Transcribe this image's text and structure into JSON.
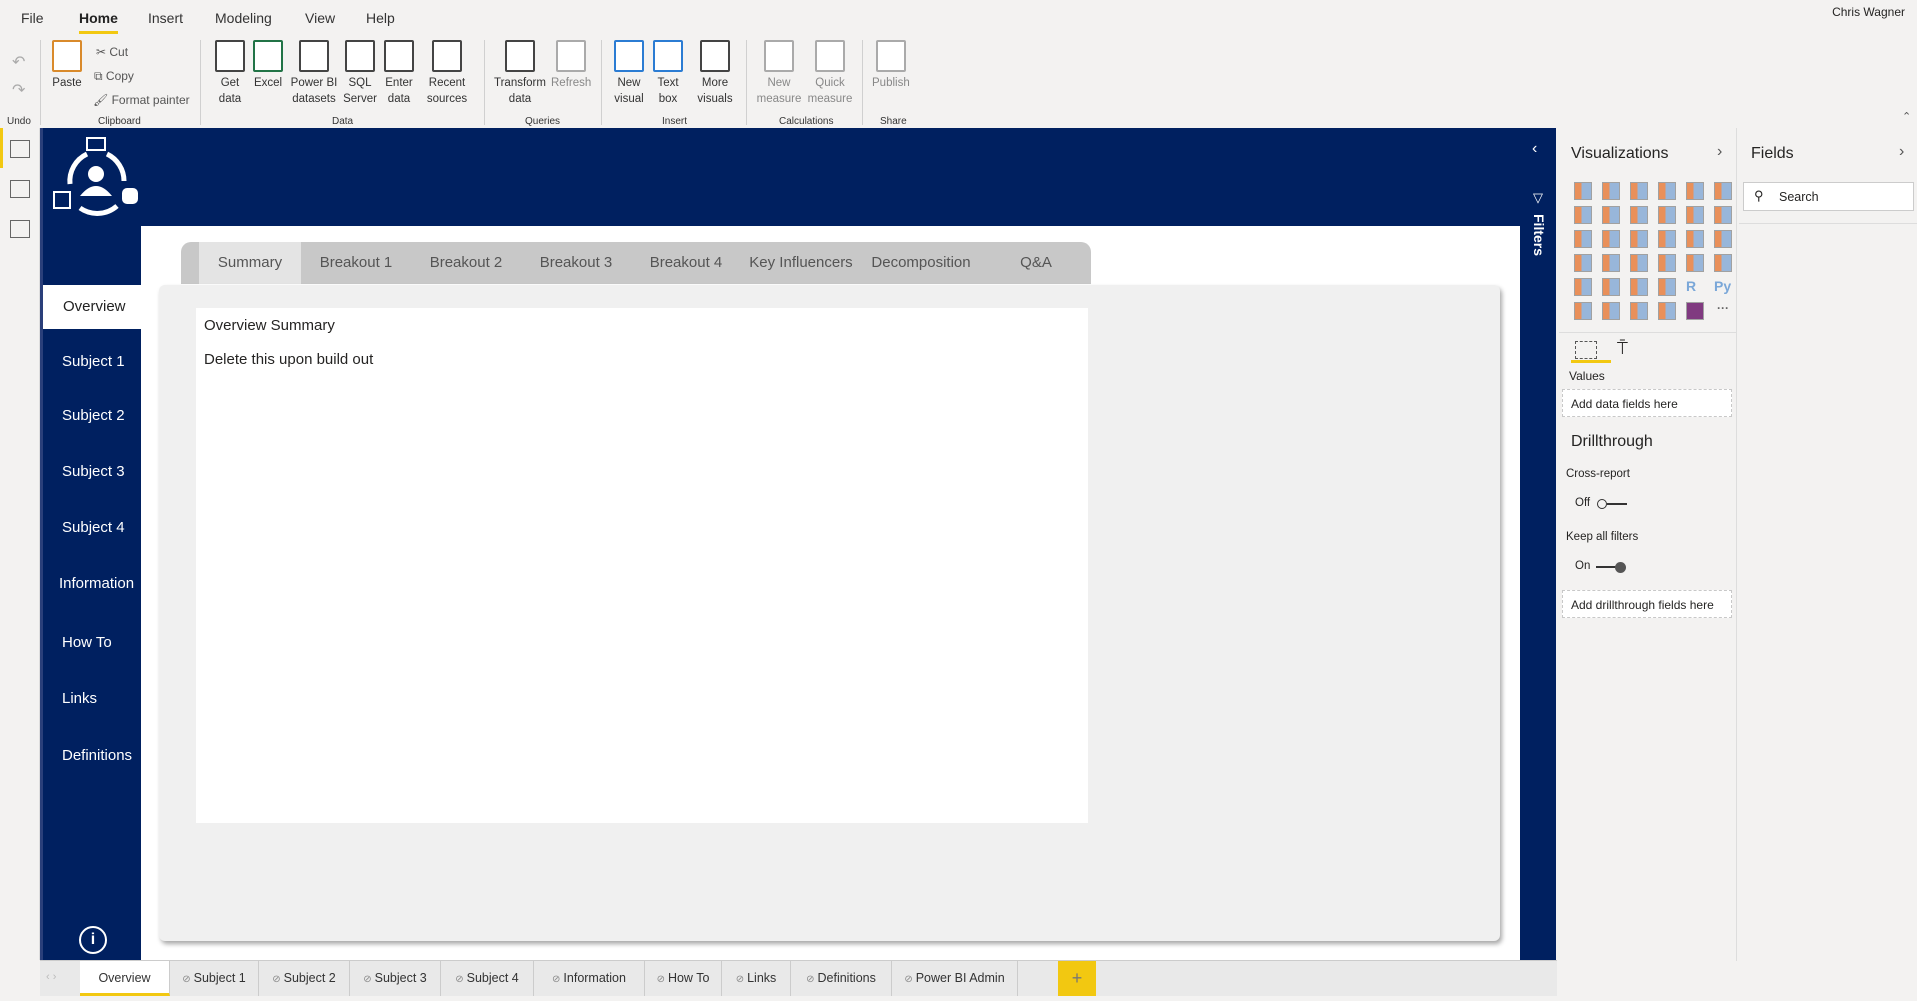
{
  "menu": {
    "file": "File",
    "home": "Home",
    "insert": "Insert",
    "modeling": "Modeling",
    "view": "View",
    "help": "Help"
  },
  "user": "Chris Wagner",
  "ribbon": {
    "undo": "Undo",
    "clipboard": {
      "paste": "Paste",
      "cut": "Cut",
      "copy": "Copy",
      "format_painter": "Format painter",
      "group": "Clipboard"
    },
    "data": {
      "get_data": "Get data",
      "excel": "Excel",
      "pbi_datasets": "Power BI datasets",
      "sql": "SQL Server",
      "enter": "Enter data",
      "recent": "Recent sources",
      "group": "Data"
    },
    "queries": {
      "transform": "Transform data",
      "refresh": "Refresh",
      "group": "Queries"
    },
    "insert": {
      "new_visual": "New visual",
      "text_box": "Text box",
      "more_visuals": "More visuals",
      "group": "Insert"
    },
    "calculations": {
      "new_measure": "New measure",
      "quick_measure": "Quick measure",
      "group": "Calculations"
    },
    "share": {
      "publish": "Publish",
      "group": "Share"
    }
  },
  "report": {
    "nav": [
      "Overview",
      "Subject 1",
      "Subject 2",
      "Subject 3",
      "Subject 4",
      "Information",
      "How To",
      "Links",
      "Definitions"
    ],
    "tabs": [
      "Summary",
      "Breakout 1",
      "Breakout 2",
      "Breakout 3",
      "Breakout 4",
      "Key Influencers",
      "Decomposition",
      "Q&A"
    ],
    "title": "Overview Summary",
    "note": "Delete this upon build out"
  },
  "filters": {
    "label": "Filters"
  },
  "visualizations": {
    "title": "Visualizations",
    "values_label": "Values",
    "add_fields": "Add data fields here",
    "drillthrough": "Drillthrough",
    "cross_report": "Cross-report",
    "cross_report_state": "Off",
    "keep_filters": "Keep all filters",
    "keep_filters_state": "On",
    "add_drill": "Add drillthrough fields here",
    "more": "···"
  },
  "fields": {
    "title": "Fields",
    "search_placeholder": "Search"
  },
  "page_tabs": [
    "Overview",
    "Subject 1",
    "Subject 2",
    "Subject 3",
    "Subject 4",
    "Information",
    "How To",
    "Links",
    "Definitions",
    "Power BI Admin"
  ],
  "add_page": "+",
  "colors": {
    "navy": "#002060",
    "accent": "#f2c811"
  }
}
